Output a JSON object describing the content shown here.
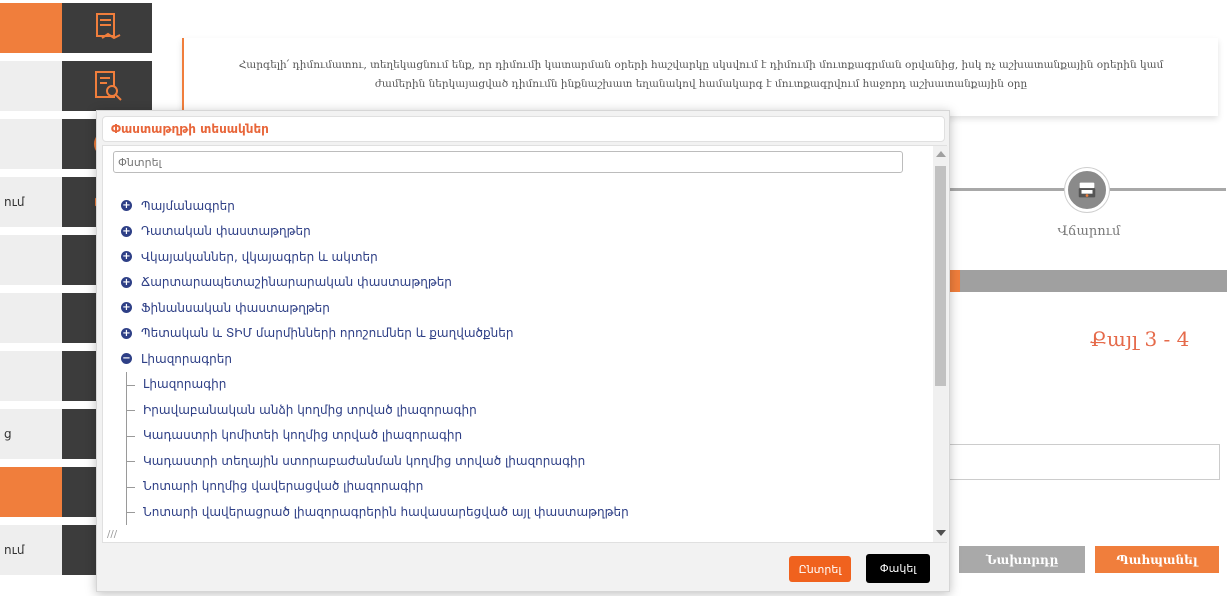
{
  "sidebar": {
    "items": [
      {
        "label": "",
        "icon": "document-handshake-icon",
        "highlight": true
      },
      {
        "label": "",
        "icon": "document-search-icon",
        "highlight": false
      },
      {
        "label": "",
        "icon": "clock-icon",
        "highlight": false
      },
      {
        "label": "ում",
        "icon": "megaphone-icon",
        "highlight": false
      },
      {
        "label": "",
        "icon": "hand-icon",
        "highlight": false
      },
      {
        "label": "",
        "icon": "certificate-icon",
        "highlight": false
      },
      {
        "label": "",
        "icon": "chart-icon",
        "highlight": false
      },
      {
        "label": "ց",
        "icon": "home-icon",
        "highlight": false
      },
      {
        "label": "",
        "icon": "document-icon",
        "highlight": true
      },
      {
        "label": "ում",
        "icon": "list-icon",
        "highlight": false
      }
    ]
  },
  "notice": {
    "text": "Հարգելի՛ դիմումատու, տեղեկացնում ենք, որ դիմումի կատարման օրերի հաշվարկը սկսվում է դիմումի մուտքագրման օրվանից, իսկ ոչ աշխատանքային օրերին կամ ժամերին ներկայացված դիմումն ինքնաշխատ եղանակով համակարգ է մուտքագրվում հաջորդ աշխատանքային օրը"
  },
  "stepper": {
    "step_label": "Վճարում",
    "step_icon": "payment-terminal-icon",
    "step_count": "Քայլ 3 - 4",
    "progress_fraction": 0.05
  },
  "buttons": {
    "previous": "Նախորդը",
    "save": "Պահպանել"
  },
  "modal": {
    "title": "Փաստաթղթի տեսակներ",
    "search_placeholder": "Փնտրել",
    "categories": [
      {
        "label": "Պայմանագրեր",
        "expanded": false
      },
      {
        "label": "Դատական փաստաթղթեր",
        "expanded": false
      },
      {
        "label": "Վկայականներ, վկայագրեր և ակտեր",
        "expanded": false
      },
      {
        "label": "Ճարտարապետաշինարարական փաստաթղթեր",
        "expanded": false
      },
      {
        "label": "Ֆինանսական փաստաթղթեր",
        "expanded": false
      },
      {
        "label": "Պետական և ՏԻՄ մարմինների որոշումներ և քաղվածքներ",
        "expanded": false
      },
      {
        "label": "Լիազորագրեր",
        "expanded": true
      }
    ],
    "children": [
      "Լիազորագիր",
      "Իրավաբանական անձի կողմից տրված լիազորագիր",
      "Կադաստրի կոմիտեի կողմից տրված լիազորագիր",
      "Կադաստրի տեղային ստորաբաժանման կողմից տրված լիազորագիր",
      "Նոտարի կողմից վավերացված լիազորագիր",
      "Նոտարի վավերացրած լիազորագրերին հավասարեցված այլ փաստաթղթեր"
    ],
    "select_label": "Ընտրել",
    "close_label": "Փակել"
  },
  "colors": {
    "accent": "#f07e3c",
    "sidebar_dark": "#3c3c3c",
    "tree_text": "#2e3f86",
    "step_count": "#e56a4a"
  }
}
